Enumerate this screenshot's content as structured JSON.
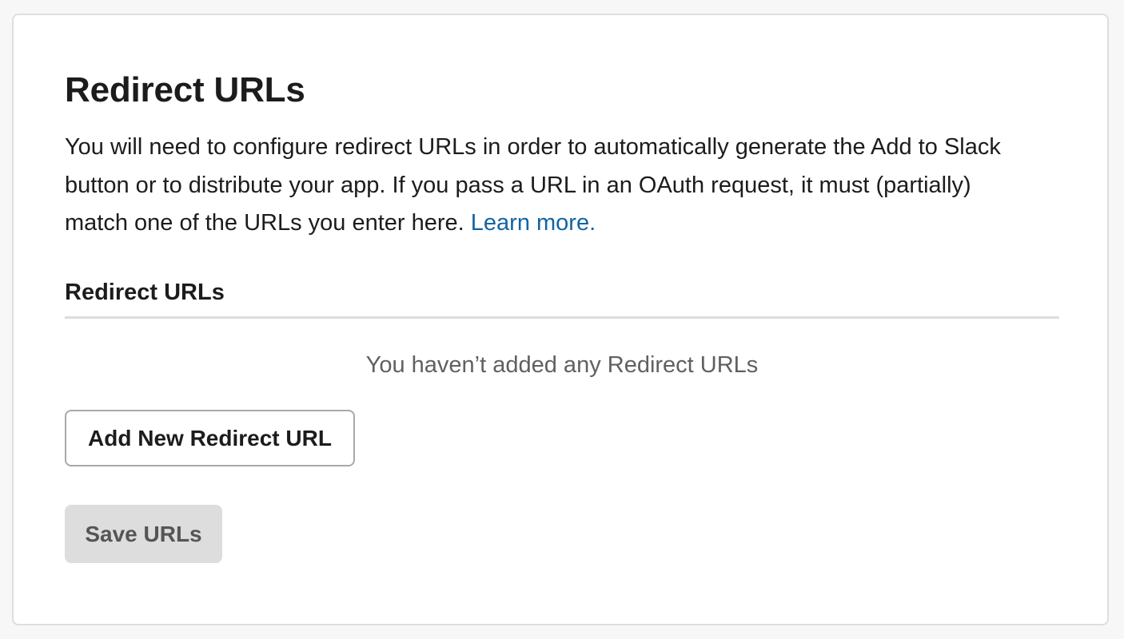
{
  "section": {
    "title": "Redirect URLs",
    "description_text": "You will need to configure redirect URLs in order to automatically generate the Add to Slack button or to distribute your app. If you pass a URL in an OAuth request, it must (partially) match one of the URLs you enter here. ",
    "learn_more_label": "Learn more."
  },
  "redirect_list": {
    "heading": "Redirect URLs",
    "empty_message": "You haven’t added any Redirect URLs"
  },
  "actions": {
    "add_label": "Add New Redirect URL",
    "save_label": "Save URLs"
  },
  "colors": {
    "link": "#1264a3",
    "text": "#1d1c1d",
    "muted": "#616061",
    "disabled_bg": "#dddddd"
  }
}
